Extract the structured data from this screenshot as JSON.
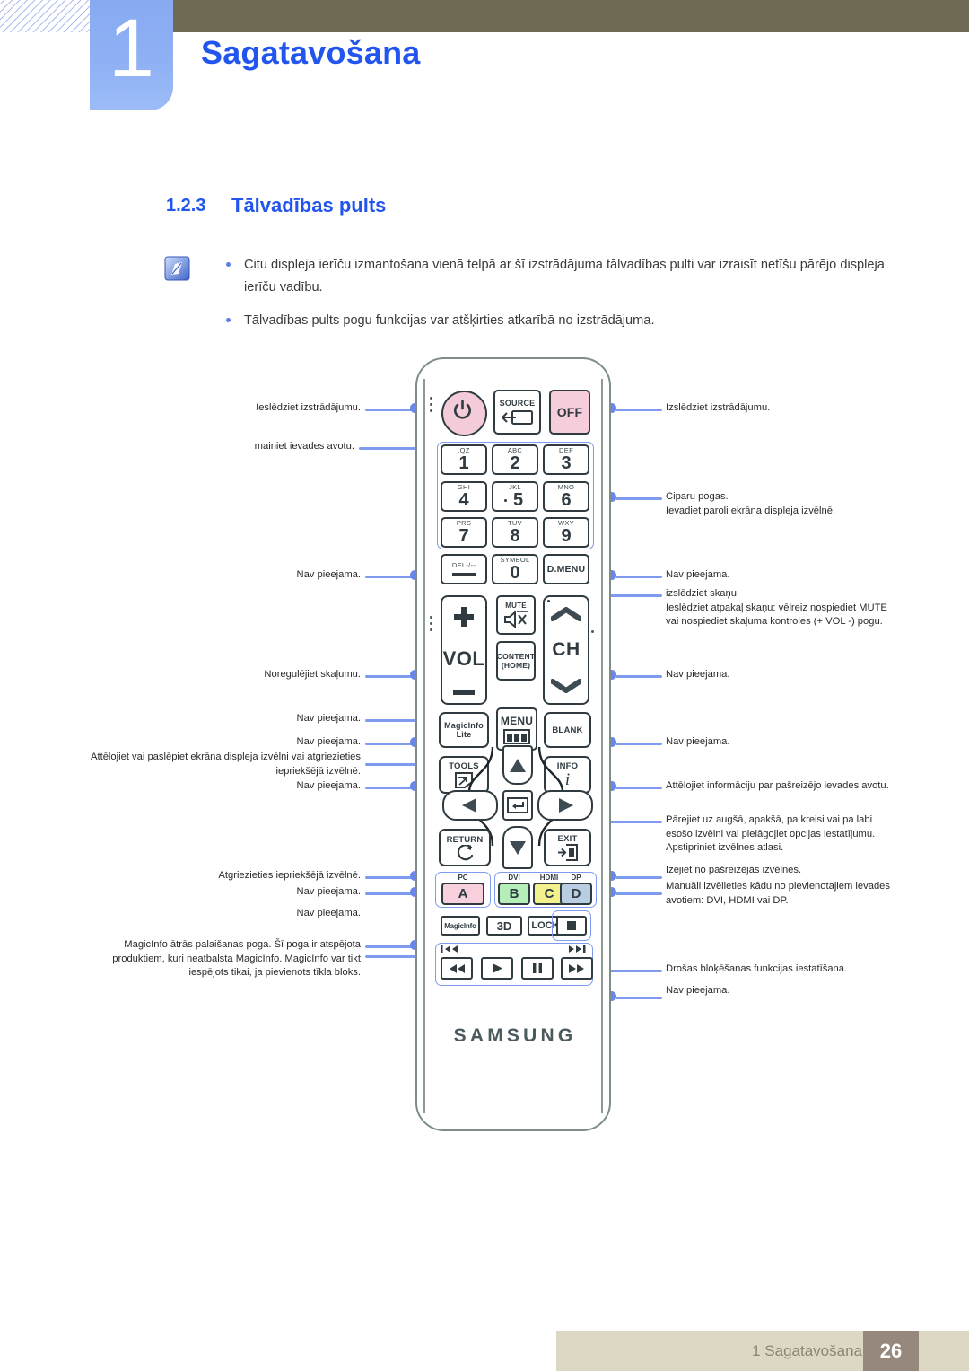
{
  "header": {
    "chapter_number": "1",
    "chapter_title": "Sagatavošana"
  },
  "section": {
    "number": "1.2.3",
    "title": "Tālvadības pults"
  },
  "notes": [
    "Citu displeja ierīču izmantošana vienā telpā ar šī izstrādājuma tālvadības pulti var izraisīt netīšu pārējo displeja ierīču vadību.",
    "Tālvadības pults pogu funkcijas var atšķirties atkarībā no izstrādājuma."
  ],
  "remote": {
    "brand": "SAMSUNG",
    "buttons": {
      "source": "SOURCE",
      "off": "OFF",
      "n1": "1",
      "n1s": ".QZ",
      "n2": "2",
      "n2s": "ABC",
      "n3": "3",
      "n3s": "DEF",
      "n4": "4",
      "n4s": "GHI",
      "n5": "5",
      "n5s": "JKL",
      "n6": "6",
      "n6s": "MNO",
      "n7": "7",
      "n7s": "PRS",
      "n8": "8",
      "n8s": "TUV",
      "n9": "9",
      "n9s": "WXY",
      "n0": "0",
      "n0s": "SYMBOL",
      "del": "DEL-/--",
      "dmenu": "D.MENU",
      "vol": "VOL",
      "mute": "MUTE",
      "ch": "CH",
      "content": "CONTENT",
      "content2": "(HOME)",
      "magicinfo_lite_1": "MagicInfo",
      "magicinfo_lite_2": "Lite",
      "menu": "MENU",
      "blank": "BLANK",
      "tools": "TOOLS",
      "info": "INFO",
      "return": "RETURN",
      "exit": "EXIT",
      "a": "A",
      "a_top": "PC",
      "b": "B",
      "b_top": "DVI",
      "c": "C",
      "c_top": "HDMI",
      "d": "D",
      "d_top": "DP",
      "magicinfo": "MagicInfo",
      "threed": "3D",
      "lock": "LOCK"
    },
    "colors": {
      "power": "#f4cbd9",
      "off": "#f6cddb",
      "a": "#f8cfdd",
      "b": "#b5eeb8",
      "c": "#f3f18d",
      "d": "#b9cde3",
      "outline": "#2f3b41",
      "shell": "#7d8d87",
      "callout": "#7f9bf0"
    }
  },
  "callouts_left": [
    {
      "text": "Ieslēdziet izstrādājumu."
    },
    {
      "text": "mainiet ievades avotu."
    },
    {
      "text": "Nav pieejama."
    },
    {
      "text": "Noregulējiet skaļumu."
    },
    {
      "text": "Nav pieejama."
    },
    {
      "text": "Nav pieejama."
    },
    {
      "text": "Attēlojiet vai paslēpiet ekrāna displeja izvēlni vai atgriezieties iepriekšējā izvēlnē."
    },
    {
      "text": "Nav pieejama."
    },
    {
      "text": "Atgriezieties iepriekšējā izvēlnē."
    },
    {
      "text": "Nav pieejama."
    },
    {
      "text": "Nav pieejama."
    },
    {
      "text": "MagicInfo ātrās palaišanas poga. Šī poga ir atspējota produktiem, kuri neatbalsta MagicInfo. MagicInfo var tikt iespējots tikai, ja pievienots tīkla bloks."
    }
  ],
  "callouts_right": [
    {
      "text": "Izslēdziet izstrādājumu."
    },
    {
      "text": "Ciparu pogas.\nIevadiet paroli ekrāna displeja izvēlnē."
    },
    {
      "text": "Nav pieejama."
    },
    {
      "text": "izslēdziet skaņu.\nIeslēdziet atpakaļ skaņu: vēlreiz nospiediet MUTE\nvai nospiediet skaļuma kontroles (+ VOL -) pogu."
    },
    {
      "text": "Nav pieejama."
    },
    {
      "text": "Nav pieejama."
    },
    {
      "text": "Attēlojiet informāciju par pašreizējo ievades avotu."
    },
    {
      "text": "Pārejiet uz augšā, apakšā, pa kreisi vai pa labi\nesošo izvēlni vai pielāgojiet opcijas iestatījumu.\nApstipriniet izvēlnes atlasi."
    },
    {
      "text": "Izejiet no pašreizējās izvēlnes."
    },
    {
      "text": "Manuāli izvēlieties kādu no pievienotajiem ievades\navotiem: DVI, HDMI vai DP."
    },
    {
      "text": "Drošas bloķēšanas funkcijas iestatīšana."
    },
    {
      "text": "Nav pieejama."
    }
  ],
  "footer": {
    "label": "1 Sagatavošana",
    "page": "26"
  }
}
